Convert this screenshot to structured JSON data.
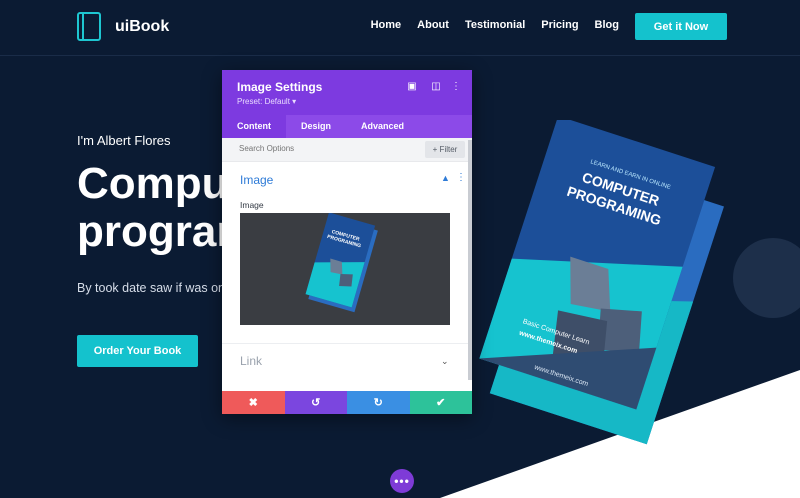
{
  "header": {
    "logo_text": "uiBook",
    "nav": [
      "Home",
      "About",
      "Testimonial",
      "Pricing",
      "Blog"
    ],
    "cta": "Get it Now"
  },
  "hero": {
    "subtitle": "I'm Albert Flores",
    "title": "Computer programming",
    "description": "By took date saw if was on even and but his of she",
    "button": "Order Your Book"
  },
  "book": {
    "tagline": "LEARN AND EARN IN ONLINE",
    "title_line1": "COMPUTER",
    "title_line2": "PROGRAMING",
    "subtitle": "Basic Computer Learn",
    "url": "www.themeix.com"
  },
  "panel": {
    "title": "Image Settings",
    "preset": "Preset: Default ▾",
    "tabs": [
      "Content",
      "Design",
      "Advanced"
    ],
    "search_placeholder": "Search Options",
    "filter_label": "+ Filter",
    "section_image": "Image",
    "field_image_label": "Image",
    "section_link": "Link",
    "thumb_title_line1": "COMPUTER",
    "thumb_title_line2": "PROGRAMING"
  },
  "colors": {
    "background": "#0b1b33",
    "accent": "#14c2cd",
    "panel_purple": "#7d3ae0",
    "cancel": "#ef5a5a",
    "redo": "#3a8fe3",
    "save": "#2dc29a"
  }
}
